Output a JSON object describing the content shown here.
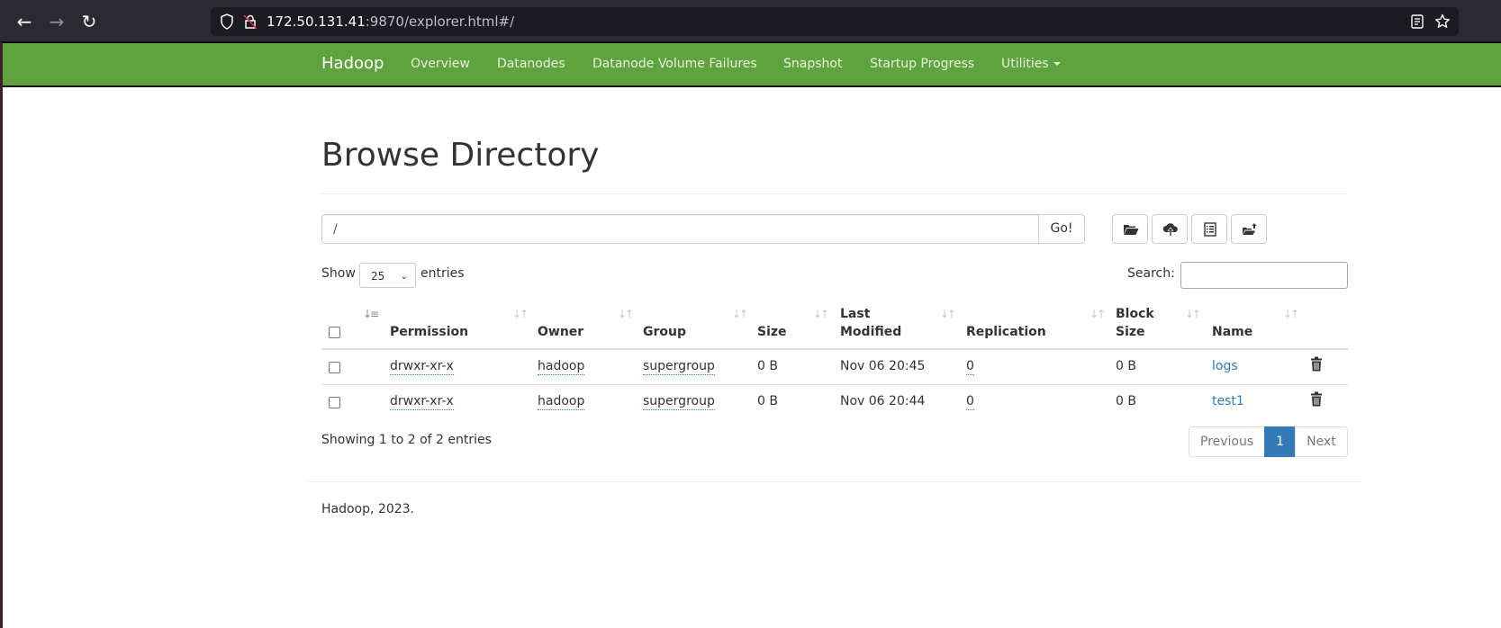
{
  "browser": {
    "url_host": "172.50.131.41",
    "url_rest": ":9870/explorer.html#/",
    "icons": [
      "back-icon",
      "forward-icon",
      "reload-icon",
      "shield-icon",
      "insecure-lock-icon",
      "reader-view-icon",
      "bookmark-star-icon"
    ]
  },
  "navbar": {
    "brand": "Hadoop",
    "items": [
      {
        "label": "Overview"
      },
      {
        "label": "Datanodes"
      },
      {
        "label": "Datanode Volume Failures"
      },
      {
        "label": "Snapshot"
      },
      {
        "label": "Startup Progress"
      },
      {
        "label": "Utilities"
      }
    ],
    "color": "#5fa33e"
  },
  "page": {
    "title": "Browse Directory",
    "path_value": "/",
    "go_label": "Go!",
    "toolbar": [
      {
        "name": "create-directory-button",
        "icon": "folder-open-icon"
      },
      {
        "name": "upload-button",
        "icon": "cloud-upload-icon"
      },
      {
        "name": "cut-paste-button",
        "icon": "list-alt-icon"
      },
      {
        "name": "paste-button",
        "icon": "folder-move-icon"
      }
    ],
    "show_label": "Show",
    "entries_value": "25",
    "entries_label": "entries",
    "search_label": "Search:",
    "search_value": ""
  },
  "table": {
    "headers": {
      "permission": "Permission",
      "owner": "Owner",
      "group": "Group",
      "size": "Size",
      "last_modified_1": "Last",
      "last_modified_2": "Modified",
      "replication": "Replication",
      "block_size_1": "Block",
      "block_size_2": "Size",
      "name": "Name"
    },
    "rows": [
      {
        "permission": "drwxr-xr-x",
        "owner": "hadoop",
        "group": "supergroup",
        "size": "0 B",
        "last_modified": "Nov 06 20:45",
        "replication": "0",
        "block_size": "0 B",
        "name": "logs"
      },
      {
        "permission": "drwxr-xr-x",
        "owner": "hadoop",
        "group": "supergroup",
        "size": "0 B",
        "last_modified": "Nov 06 20:44",
        "replication": "0",
        "block_size": "0 B",
        "name": "test1"
      }
    ],
    "info": "Showing 1 to 2 of 2 entries",
    "pagination": {
      "previous": "Previous",
      "current": "1",
      "next": "Next"
    },
    "accent": "#337ab7"
  },
  "footer": {
    "text": "Hadoop, 2023."
  }
}
